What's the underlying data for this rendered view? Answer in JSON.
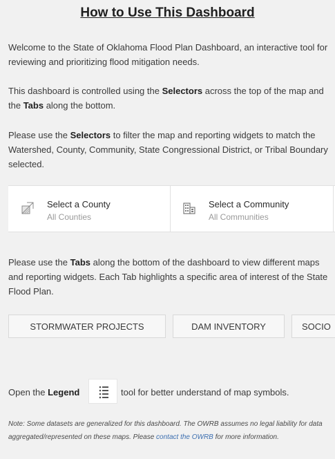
{
  "title": "How to Use This Dashboard",
  "intro": {
    "text": "Welcome to the State of Oklahoma Flood Plan Dashboard, an interactive tool for reviewing and prioritizing flood mitigation needs."
  },
  "controls": {
    "pre": "This dashboard is controlled using the ",
    "selectors": "Selectors",
    "mid": " across the top of the map and the ",
    "tabs": "Tabs",
    "post": " along the bottom."
  },
  "selectors_help": {
    "pre": "Please use the ",
    "selectors": "Selectors",
    "post": " to filter the map and reporting widgets to match the Watershed, County, Community, State Congressional District, or Tribal Boundary selected."
  },
  "selector_bar": {
    "items": [
      {
        "title": "Select a County",
        "value": "All Counties",
        "icon": "county-map-icon"
      },
      {
        "title": "Select a Community",
        "value": "All Communities",
        "icon": "buildings-icon"
      }
    ]
  },
  "tabs_help": {
    "pre": "Please use the ",
    "tabs": "Tabs",
    "post": " along the bottom of the dashboard to view different maps and reporting widgets. Each Tab highlights a specific area of interest of the State Flood Plan."
  },
  "tabs": [
    {
      "label": "STORMWATER PROJECTS"
    },
    {
      "label": "DAM INVENTORY"
    },
    {
      "label": "SOCIO"
    }
  ],
  "legend": {
    "pre": "Open the ",
    "legend": "Legend",
    "post": "tool for better understand of map symbols.",
    "icon": "legend-list-icon"
  },
  "note": {
    "pre": "Note: Some datasets are generalized for this dashboard. The OWRB assumes no legal liability for data aggregated/represented on these maps. Please ",
    "link": "contact the OWRB",
    "post": " for more information.",
    "link_color": "#3d6fb0"
  }
}
